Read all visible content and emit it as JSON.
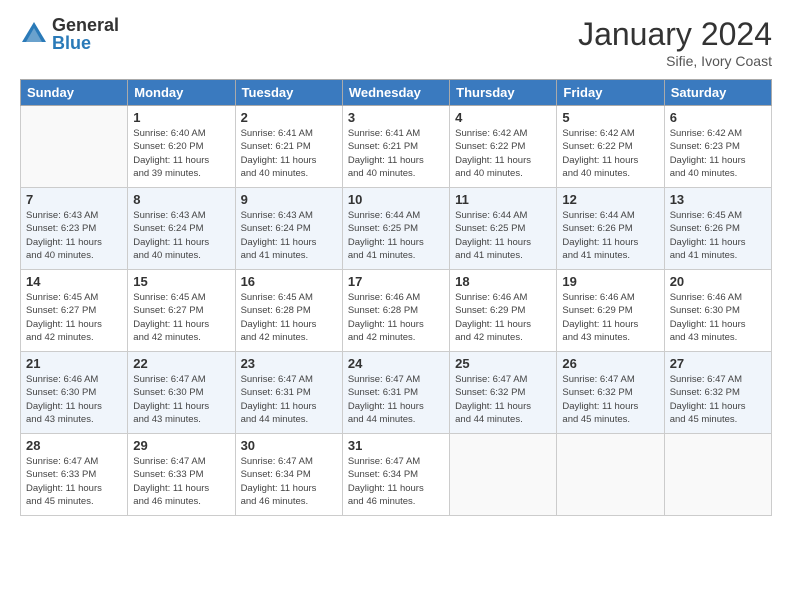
{
  "header": {
    "logo": {
      "general": "General",
      "blue": "Blue"
    },
    "title": "January 2024",
    "location": "Sifie, Ivory Coast"
  },
  "calendar": {
    "days_of_week": [
      "Sunday",
      "Monday",
      "Tuesday",
      "Wednesday",
      "Thursday",
      "Friday",
      "Saturday"
    ],
    "weeks": [
      [
        {
          "day": "",
          "info": ""
        },
        {
          "day": "1",
          "info": "Sunrise: 6:40 AM\nSunset: 6:20 PM\nDaylight: 11 hours\nand 39 minutes."
        },
        {
          "day": "2",
          "info": "Sunrise: 6:41 AM\nSunset: 6:21 PM\nDaylight: 11 hours\nand 40 minutes."
        },
        {
          "day": "3",
          "info": "Sunrise: 6:41 AM\nSunset: 6:21 PM\nDaylight: 11 hours\nand 40 minutes."
        },
        {
          "day": "4",
          "info": "Sunrise: 6:42 AM\nSunset: 6:22 PM\nDaylight: 11 hours\nand 40 minutes."
        },
        {
          "day": "5",
          "info": "Sunrise: 6:42 AM\nSunset: 6:22 PM\nDaylight: 11 hours\nand 40 minutes."
        },
        {
          "day": "6",
          "info": "Sunrise: 6:42 AM\nSunset: 6:23 PM\nDaylight: 11 hours\nand 40 minutes."
        }
      ],
      [
        {
          "day": "7",
          "info": "Sunrise: 6:43 AM\nSunset: 6:23 PM\nDaylight: 11 hours\nand 40 minutes."
        },
        {
          "day": "8",
          "info": "Sunrise: 6:43 AM\nSunset: 6:24 PM\nDaylight: 11 hours\nand 40 minutes."
        },
        {
          "day": "9",
          "info": "Sunrise: 6:43 AM\nSunset: 6:24 PM\nDaylight: 11 hours\nand 41 minutes."
        },
        {
          "day": "10",
          "info": "Sunrise: 6:44 AM\nSunset: 6:25 PM\nDaylight: 11 hours\nand 41 minutes."
        },
        {
          "day": "11",
          "info": "Sunrise: 6:44 AM\nSunset: 6:25 PM\nDaylight: 11 hours\nand 41 minutes."
        },
        {
          "day": "12",
          "info": "Sunrise: 6:44 AM\nSunset: 6:26 PM\nDaylight: 11 hours\nand 41 minutes."
        },
        {
          "day": "13",
          "info": "Sunrise: 6:45 AM\nSunset: 6:26 PM\nDaylight: 11 hours\nand 41 minutes."
        }
      ],
      [
        {
          "day": "14",
          "info": "Sunrise: 6:45 AM\nSunset: 6:27 PM\nDaylight: 11 hours\nand 42 minutes."
        },
        {
          "day": "15",
          "info": "Sunrise: 6:45 AM\nSunset: 6:27 PM\nDaylight: 11 hours\nand 42 minutes."
        },
        {
          "day": "16",
          "info": "Sunrise: 6:45 AM\nSunset: 6:28 PM\nDaylight: 11 hours\nand 42 minutes."
        },
        {
          "day": "17",
          "info": "Sunrise: 6:46 AM\nSunset: 6:28 PM\nDaylight: 11 hours\nand 42 minutes."
        },
        {
          "day": "18",
          "info": "Sunrise: 6:46 AM\nSunset: 6:29 PM\nDaylight: 11 hours\nand 42 minutes."
        },
        {
          "day": "19",
          "info": "Sunrise: 6:46 AM\nSunset: 6:29 PM\nDaylight: 11 hours\nand 43 minutes."
        },
        {
          "day": "20",
          "info": "Sunrise: 6:46 AM\nSunset: 6:30 PM\nDaylight: 11 hours\nand 43 minutes."
        }
      ],
      [
        {
          "day": "21",
          "info": "Sunrise: 6:46 AM\nSunset: 6:30 PM\nDaylight: 11 hours\nand 43 minutes."
        },
        {
          "day": "22",
          "info": "Sunrise: 6:47 AM\nSunset: 6:30 PM\nDaylight: 11 hours\nand 43 minutes."
        },
        {
          "day": "23",
          "info": "Sunrise: 6:47 AM\nSunset: 6:31 PM\nDaylight: 11 hours\nand 44 minutes."
        },
        {
          "day": "24",
          "info": "Sunrise: 6:47 AM\nSunset: 6:31 PM\nDaylight: 11 hours\nand 44 minutes."
        },
        {
          "day": "25",
          "info": "Sunrise: 6:47 AM\nSunset: 6:32 PM\nDaylight: 11 hours\nand 44 minutes."
        },
        {
          "day": "26",
          "info": "Sunrise: 6:47 AM\nSunset: 6:32 PM\nDaylight: 11 hours\nand 45 minutes."
        },
        {
          "day": "27",
          "info": "Sunrise: 6:47 AM\nSunset: 6:32 PM\nDaylight: 11 hours\nand 45 minutes."
        }
      ],
      [
        {
          "day": "28",
          "info": "Sunrise: 6:47 AM\nSunset: 6:33 PM\nDaylight: 11 hours\nand 45 minutes."
        },
        {
          "day": "29",
          "info": "Sunrise: 6:47 AM\nSunset: 6:33 PM\nDaylight: 11 hours\nand 46 minutes."
        },
        {
          "day": "30",
          "info": "Sunrise: 6:47 AM\nSunset: 6:34 PM\nDaylight: 11 hours\nand 46 minutes."
        },
        {
          "day": "31",
          "info": "Sunrise: 6:47 AM\nSunset: 6:34 PM\nDaylight: 11 hours\nand 46 minutes."
        },
        {
          "day": "",
          "info": ""
        },
        {
          "day": "",
          "info": ""
        },
        {
          "day": "",
          "info": ""
        }
      ]
    ]
  }
}
